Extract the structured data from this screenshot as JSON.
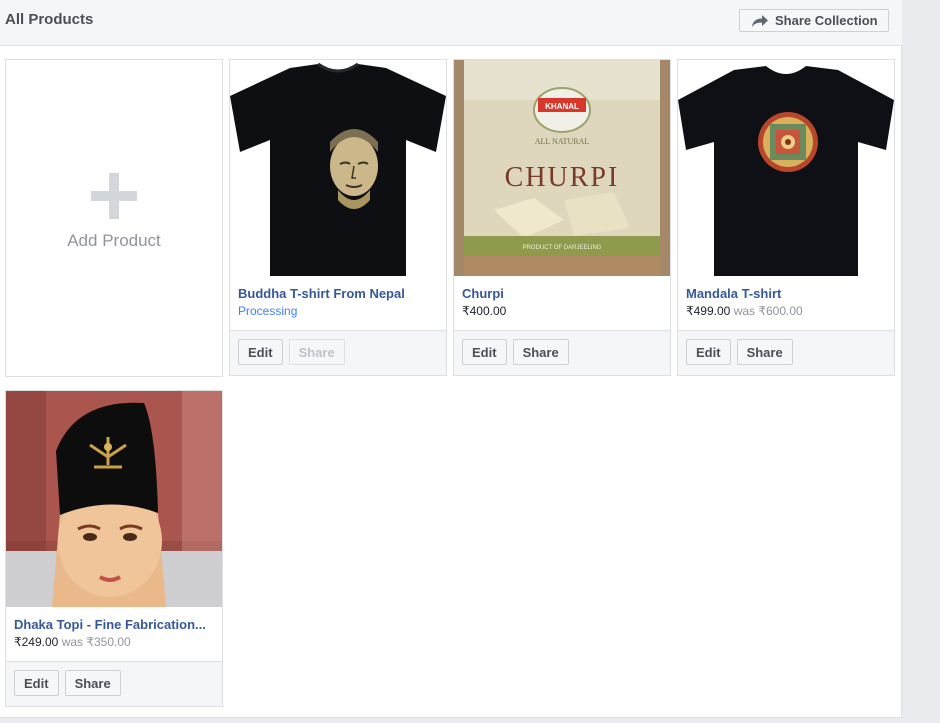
{
  "header": {
    "title": "All Products",
    "share_collection_label": "Share Collection"
  },
  "add_product": {
    "label": "Add Product"
  },
  "products": [
    {
      "name": "Buddha T-shirt From Nepal",
      "status": "Processing",
      "edit_label": "Edit",
      "share_label": "Share",
      "share_enabled": false
    },
    {
      "name": "Churpi",
      "price": "₹400.00",
      "edit_label": "Edit",
      "share_label": "Share",
      "share_enabled": true,
      "image_text": {
        "brand": "KHANAL",
        "tagline": "ALL NATURAL",
        "product": "CHURPI",
        "origin": "PRODUCT OF DARJEELING"
      }
    },
    {
      "name": "Mandala T-shirt",
      "price": "₹499.00",
      "was_label": "was",
      "was_price": "₹600.00",
      "edit_label": "Edit",
      "share_label": "Share",
      "share_enabled": true
    },
    {
      "name": "Dhaka Topi - Fine Fabrication...",
      "price": "₹249.00",
      "was_label": "was",
      "was_price": "₹350.00",
      "edit_label": "Edit",
      "share_label": "Share",
      "share_enabled": true
    }
  ],
  "colors": {
    "link": "#365899",
    "status_blue": "#4080ff",
    "muted": "#90949c"
  },
  "icons": {
    "share_collection": "share-arrow-icon",
    "add_product": "plus-icon"
  }
}
